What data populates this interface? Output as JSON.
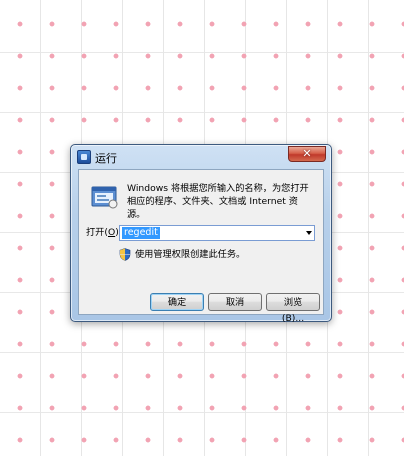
{
  "dialog": {
    "title": "运行",
    "close_glyph": "✕",
    "description": "Windows 将根据您所输入的名称，为您打开相应的程序、文件夹、文档或 Internet 资源。",
    "open_label_prefix": "打开(",
    "open_label_key": "O",
    "open_label_suffix": "):",
    "open_value": "regedit",
    "admin_note": "使用管理权限创建此任务。",
    "buttons": {
      "ok": "确定",
      "cancel": "取消",
      "browse": "浏览(B)..."
    }
  },
  "icons": {
    "title": "run-dialog-icon",
    "run": "run-program-icon",
    "shield": "uac-shield-icon",
    "close": "close-icon",
    "dropdown": "chevron-down-icon"
  },
  "colors": {
    "selection": "#3399ff",
    "close_button": "#c0392b",
    "titlebar": "#b7d0ea"
  }
}
